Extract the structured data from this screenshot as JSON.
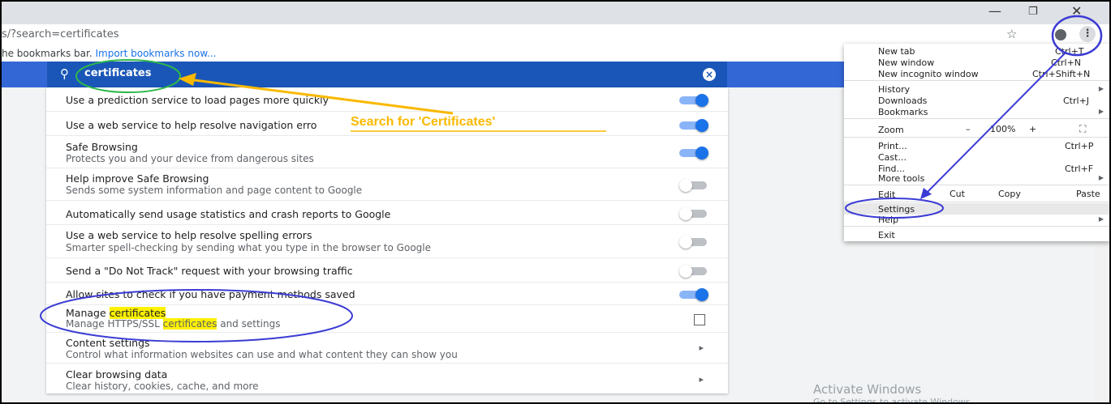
{
  "browser": {
    "url": "s/?search=certificates",
    "bookmarks_prefix": "he bookmarks bar. ",
    "bookmarks_link": "Import bookmarks now..."
  },
  "search": {
    "query": "certificates"
  },
  "annotation": "Search for 'Certificates'",
  "rows": [
    {
      "title": "Use a prediction service to load pages more quickly",
      "control": "toggle-on"
    },
    {
      "title": "Use a web service to help resolve navigation erro",
      "control": "toggle-on"
    },
    {
      "title": "Safe Browsing",
      "subtitle": "Protects you and your device from dangerous sites",
      "control": "toggle-on"
    },
    {
      "title": "Help improve Safe Browsing",
      "subtitle": "Sends some system information and page content to Google",
      "control": "toggle-off"
    },
    {
      "title": "Automatically send usage statistics and crash reports to Google",
      "control": "toggle-off"
    },
    {
      "title": "Use a web service to help resolve spelling errors",
      "subtitle": "Smarter spell-checking by sending what you type in the browser to Google",
      "control": "toggle-off"
    },
    {
      "title": "Send a \"Do Not Track\" request with your browsing traffic",
      "control": "toggle-off"
    },
    {
      "title": "Allow sites to check if you have payment methods saved",
      "control": "toggle-on"
    },
    {
      "title_prefix": "Manage ",
      "title_hl": "certificates",
      "subtitle_prefix": "Manage HTTPS/SSL ",
      "subtitle_hl": "certificates",
      "subtitle_suffix": " and settings",
      "control": "external"
    },
    {
      "title": "Content settings",
      "subtitle": "Control what information websites can use and what content they can show you",
      "control": "arrow"
    },
    {
      "title": "Clear browsing data",
      "subtitle": "Clear history, cookies, cache, and more",
      "control": "arrow"
    }
  ],
  "menu": {
    "new_tab": "New tab",
    "new_tab_sc": "Ctrl+T",
    "new_window": "New window",
    "new_window_sc": "Ctrl+N",
    "incognito": "New incognito window",
    "incognito_sc": "Ctrl+Shift+N",
    "history": "History",
    "downloads": "Downloads",
    "downloads_sc": "Ctrl+J",
    "bookmarks": "Bookmarks",
    "zoom": "Zoom",
    "zoom_minus": "–",
    "zoom_value": "100%",
    "zoom_plus": "+",
    "print": "Print...",
    "print_sc": "Ctrl+P",
    "cast": "Cast...",
    "find": "Find...",
    "find_sc": "Ctrl+F",
    "more_tools": "More tools",
    "edit": "Edit",
    "cut": "Cut",
    "copy": "Copy",
    "paste": "Paste",
    "settings": "Settings",
    "help": "Help",
    "exit": "Exit"
  },
  "activate": {
    "line1": "Activate Windows",
    "line2": "Go to Settings to activate Windows."
  },
  "colors": {
    "header_blue": "#3367d6",
    "toggle_on": "#1a73e8",
    "annotation_yellow": "#f9b900",
    "annotation_blue": "#3b3bd4",
    "annotation_green": "#2db84a"
  }
}
